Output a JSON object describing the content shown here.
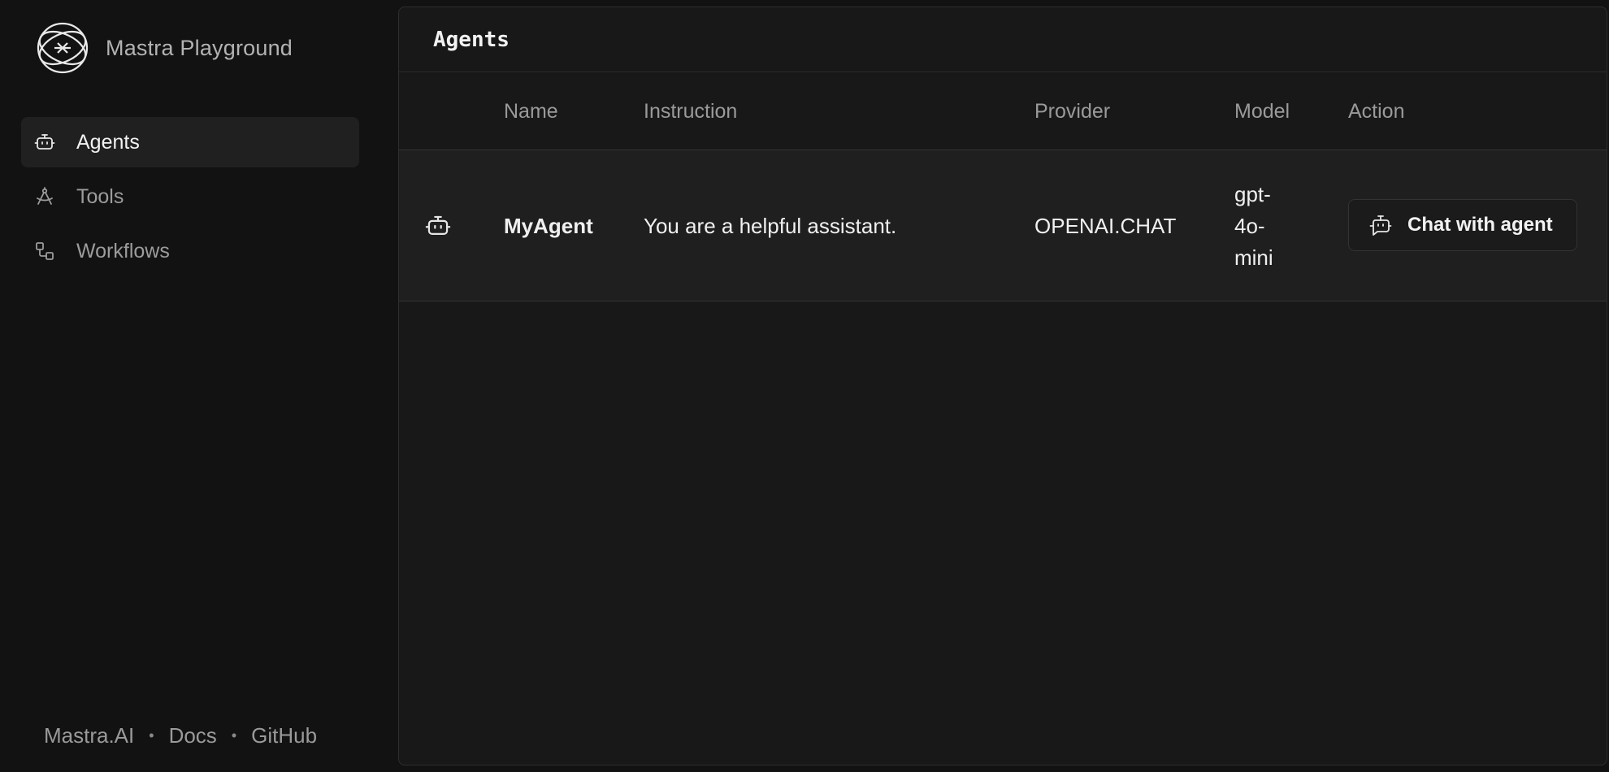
{
  "sidebar": {
    "brand": {
      "title": "Mastra Playground",
      "logo_icon": "mastra-logo-icon"
    },
    "nav": [
      {
        "label": "Agents",
        "icon": "bot-icon",
        "active": true
      },
      {
        "label": "Tools",
        "icon": "compass-tool-icon",
        "active": false
      },
      {
        "label": "Workflows",
        "icon": "workflow-icon",
        "active": false
      }
    ],
    "footer": {
      "link_1": "Mastra.AI",
      "link_2": "Docs",
      "link_3": "GitHub",
      "separator": "•"
    }
  },
  "main": {
    "title": "Agents",
    "table": {
      "columns": {
        "name": "Name",
        "instruction": "Instruction",
        "provider": "Provider",
        "model": "Model",
        "action": "Action"
      },
      "rows": [
        {
          "icon": "bot-icon",
          "name": "MyAgent",
          "instruction": "You are a helpful assistant.",
          "provider": "OPENAI.CHAT",
          "model": "gpt-4o-mini",
          "action_label": "Chat with agent",
          "action_icon": "bot-message-icon"
        }
      ]
    }
  },
  "colors": {
    "background": "#121212",
    "panel": "#181818",
    "row_background": "#1f1f1f",
    "active_nav": "#202020",
    "text_primary": "#f0f0f0",
    "text_muted": "#9a9a9a"
  }
}
